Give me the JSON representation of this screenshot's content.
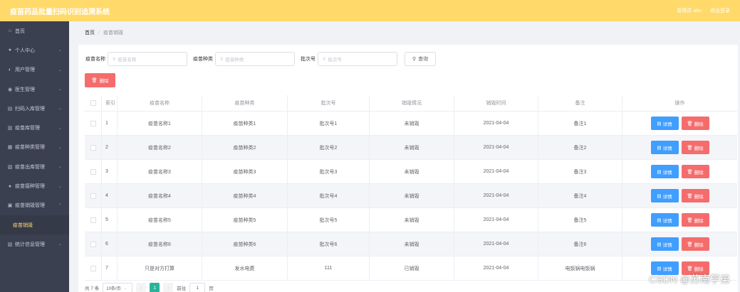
{
  "header": {
    "title": "疫苗药品批量扫码识别追溯系统",
    "admin": "管理员 abo",
    "logout": "退出登录"
  },
  "sidebar": {
    "items": [
      {
        "label": "首页",
        "icon": "home-icon",
        "arrow": false
      },
      {
        "label": "个人中心",
        "icon": "user-icon",
        "arrow": true
      },
      {
        "label": "用户管理",
        "icon": "users-icon",
        "arrow": true
      },
      {
        "label": "医生管理",
        "icon": "doctor-icon",
        "arrow": true
      },
      {
        "label": "扫码入库管理",
        "icon": "scan-icon",
        "arrow": true
      },
      {
        "label": "疫苗库管理",
        "icon": "warehouse-icon",
        "arrow": true
      },
      {
        "label": "疫苗种类管理",
        "icon": "category-icon",
        "arrow": true
      },
      {
        "label": "疫苗出库管理",
        "icon": "export-icon",
        "arrow": true
      },
      {
        "label": "疫苗接种管理",
        "icon": "vaccinate-icon",
        "arrow": true
      },
      {
        "label": "疫苗销毁管理",
        "icon": "destroy-icon",
        "arrow": true
      },
      {
        "label": "疫苗销毁",
        "icon": "",
        "arrow": false,
        "sub": true
      },
      {
        "label": "统计信息管理",
        "icon": "stats-icon",
        "arrow": true
      }
    ]
  },
  "breadcrumb": {
    "home": "首页",
    "separator": "/",
    "current": "疫苗销毁"
  },
  "search": {
    "name_label": "疫苗名称",
    "name_placeholder": "疫苗名称",
    "type_label": "疫苗种类",
    "type_placeholder": "疫苗种类",
    "batch_label": "批次号",
    "batch_placeholder": "批次号",
    "query_label": "查询"
  },
  "toolbar": {
    "delete_label": "删除"
  },
  "table": {
    "headers": [
      "索引",
      "疫苗名称",
      "疫苗种类",
      "批次号",
      "销毁情况",
      "销毁时间",
      "备注",
      "操作"
    ],
    "detail_label": "详情",
    "delete_label": "删除",
    "rows": [
      {
        "idx": "1",
        "name": "疫苗名称1",
        "type": "疫苗种类1",
        "batch": "批次号1",
        "status": "未销毁",
        "time": "2021-04-04",
        "note": "备注1"
      },
      {
        "idx": "2",
        "name": "疫苗名称2",
        "type": "疫苗种类2",
        "batch": "批次号2",
        "status": "未销毁",
        "time": "2021-04-04",
        "note": "备注2"
      },
      {
        "idx": "3",
        "name": "疫苗名称3",
        "type": "疫苗种类3",
        "batch": "批次号3",
        "status": "未销毁",
        "time": "2021-04-04",
        "note": "备注3"
      },
      {
        "idx": "4",
        "name": "疫苗名称4",
        "type": "疫苗种类4",
        "batch": "批次号4",
        "status": "未销毁",
        "time": "2021-04-04",
        "note": "备注4"
      },
      {
        "idx": "5",
        "name": "疫苗名称5",
        "type": "疫苗种类5",
        "batch": "批次号5",
        "status": "未销毁",
        "time": "2021-04-04",
        "note": "备注5"
      },
      {
        "idx": "6",
        "name": "疫苗名称6",
        "type": "疫苗种类6",
        "batch": "批次号6",
        "status": "未销毁",
        "time": "2021-04-04",
        "note": "备注6"
      },
      {
        "idx": "7",
        "name": "只是对方打算",
        "type": "发水电费",
        "batch": "111",
        "status": "已销毁",
        "time": "2021-04-04",
        "note": "电饭锅电饭锅"
      }
    ]
  },
  "pagination": {
    "total": "共 7 条",
    "page_size": "10条/页",
    "prev": "‹",
    "current_page": "1",
    "next": "›",
    "goto_label": "前往",
    "goto_value": "1",
    "page_unit": "页"
  },
  "watermark": "CSDN @苏南学弟",
  "colors": {
    "header": "#ffd96a",
    "sidebar": "#3b4050",
    "danger": "#f56c6c",
    "primary": "#409eff",
    "pager_active": "#2bb39a"
  }
}
